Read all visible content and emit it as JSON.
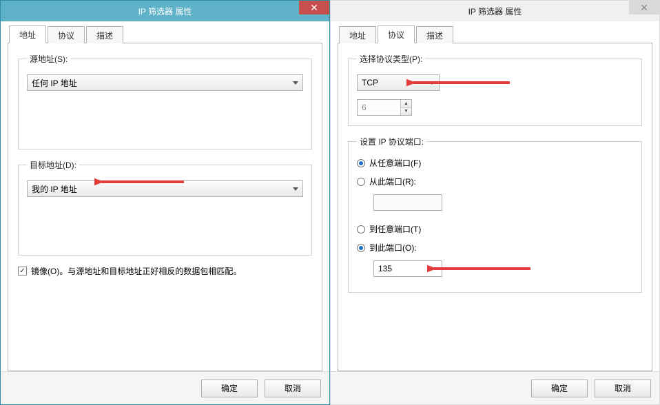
{
  "left": {
    "title": "IP 筛选器 属性",
    "close": "✕",
    "tabs": {
      "address": "地址",
      "protocol": "协议",
      "description": "描述"
    },
    "source": {
      "legend": "源地址(S):",
      "value": "任何 IP 地址"
    },
    "dest": {
      "legend": "目标地址(D):",
      "value": "我的 IP 地址"
    },
    "mirror_label": "镜像(O)。与源地址和目标地址正好相反的数据包相匹配。",
    "ok": "确定",
    "cancel": "取消"
  },
  "right": {
    "title": "IP 筛选器 属性",
    "close": "✕",
    "tabs": {
      "address": "地址",
      "protocol": "协议",
      "description": "描述"
    },
    "proto": {
      "legend": "选择协议类型(P):",
      "value": "TCP",
      "number": "6"
    },
    "ports": {
      "legend": "设置 IP 协议端口:",
      "from_any": "从任意端口(F)",
      "from_this": "从此端口(R):",
      "from_val": "",
      "to_any": "到任意端口(T)",
      "to_this": "到此端口(O):",
      "to_val": "135"
    },
    "ok": "确定",
    "cancel": "取消"
  },
  "colors": {
    "arrow": "#e23b3b"
  }
}
